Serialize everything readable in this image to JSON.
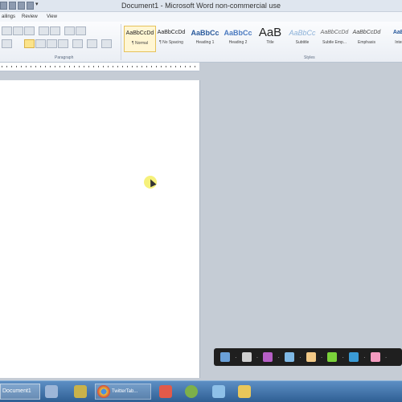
{
  "window": {
    "title": "Document1 - Microsoft Word non-commercial use"
  },
  "menu": {
    "items": [
      "ailings",
      "Review",
      "View"
    ]
  },
  "ribbon": {
    "paragraph_label": "Paragraph",
    "styles_label": "Styles",
    "styles": [
      {
        "sample": "AaBbCcDd",
        "name": "¶ Normal",
        "selected": true
      },
      {
        "sample": "AaBbCcDd",
        "name": "¶ No Spacing"
      },
      {
        "sample": "AaBbCc",
        "name": "Heading 1"
      },
      {
        "sample": "AaBbCc",
        "name": "Heading 2"
      },
      {
        "sample": "AaB",
        "name": "Title"
      },
      {
        "sample": "AaBbCc",
        "name": "Subtitle"
      },
      {
        "sample": "AaBbCcDd",
        "name": "Subtle Emp..."
      },
      {
        "sample": "AaBbCcDd",
        "name": "Emphasis"
      },
      {
        "sample": "AaBb",
        "name": "Intens"
      }
    ]
  },
  "taskbar": {
    "doc_label": "Document1",
    "twitter_label": "TwitterTab..."
  },
  "colors": {
    "accent": "#fbe38a",
    "taskbar": "#3a6ea5",
    "pen_toolbar": "#1f1f1f"
  }
}
